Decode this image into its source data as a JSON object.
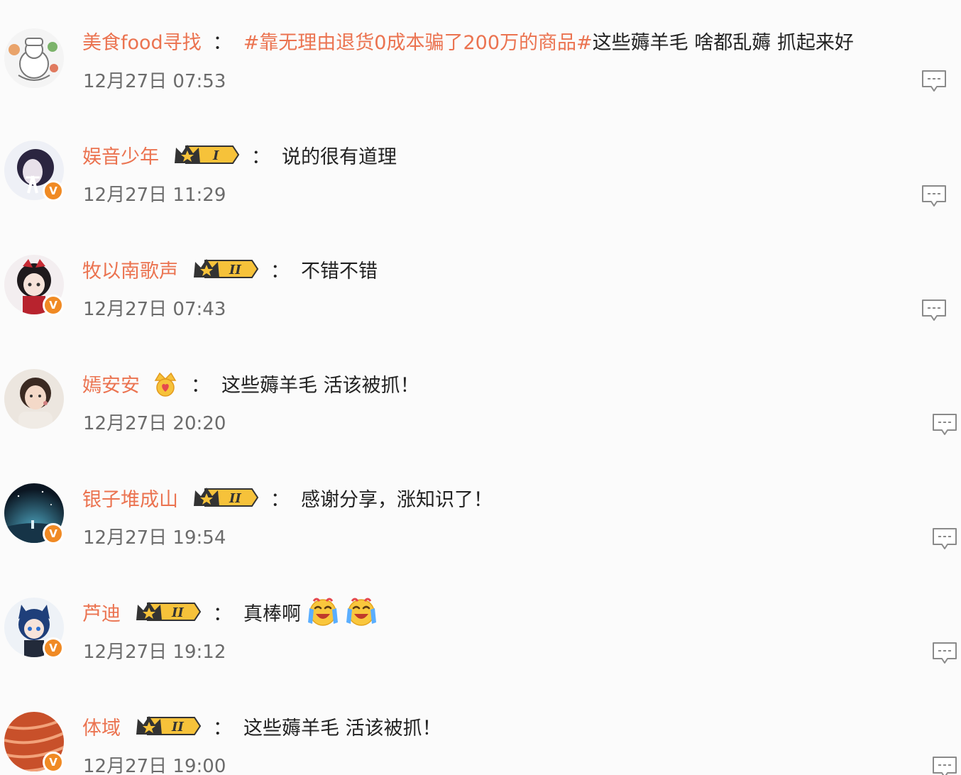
{
  "comments": [
    {
      "username": "美食food寻找",
      "colon": "：",
      "hashtag": "#靠无理由退货0成本骗了200万的商品#",
      "content": "这些薅羊毛 啥都乱薅 抓起来好",
      "time": "12月27日 07:53",
      "verified": false,
      "badge": "none"
    },
    {
      "username": "娱音少年",
      "colon": "：",
      "content": "说的很有道理",
      "time": "12月27日 11:29",
      "verified": true,
      "verified_mark": "V",
      "badge": "level",
      "badge_level": "I"
    },
    {
      "username": "牧以南歌声",
      "colon": "：",
      "content": "不错不错",
      "time": "12月27日 07:43",
      "verified": true,
      "verified_mark": "V",
      "badge": "level",
      "badge_level": "II"
    },
    {
      "username": "嫣安安",
      "colon": "：",
      "content": "这些薅羊毛 活该被抓！",
      "time": "12月27日 20:20",
      "verified": false,
      "badge": "crown"
    },
    {
      "username": "银子堆成山",
      "colon": "：",
      "content": "感谢分享，涨知识了！",
      "time": "12月27日 19:54",
      "verified": true,
      "verified_mark": "V",
      "badge": "level",
      "badge_level": "II"
    },
    {
      "username": "芦迪",
      "colon": "：",
      "content": "真棒啊",
      "emojis": [
        "crying-laughing-emoji",
        "crying-laughing-emoji"
      ],
      "time": "12月27日 19:12",
      "verified": true,
      "verified_mark": "V",
      "badge": "level",
      "badge_level": "II"
    },
    {
      "username": "体域",
      "colon": "：",
      "content": "这些薅羊毛 活该被抓！",
      "time": "12月27日 19:00",
      "verified": true,
      "verified_mark": "V",
      "badge": "level",
      "badge_level": "II"
    }
  ],
  "colors": {
    "username": "#eb7350",
    "hashtag": "#eb7350",
    "content": "#222222",
    "time": "#6b6b6b",
    "verified": "#f08a24",
    "badge_gold": "#f6c23a",
    "badge_dark": "#333333",
    "reply_icon": "#8a8a8a"
  }
}
